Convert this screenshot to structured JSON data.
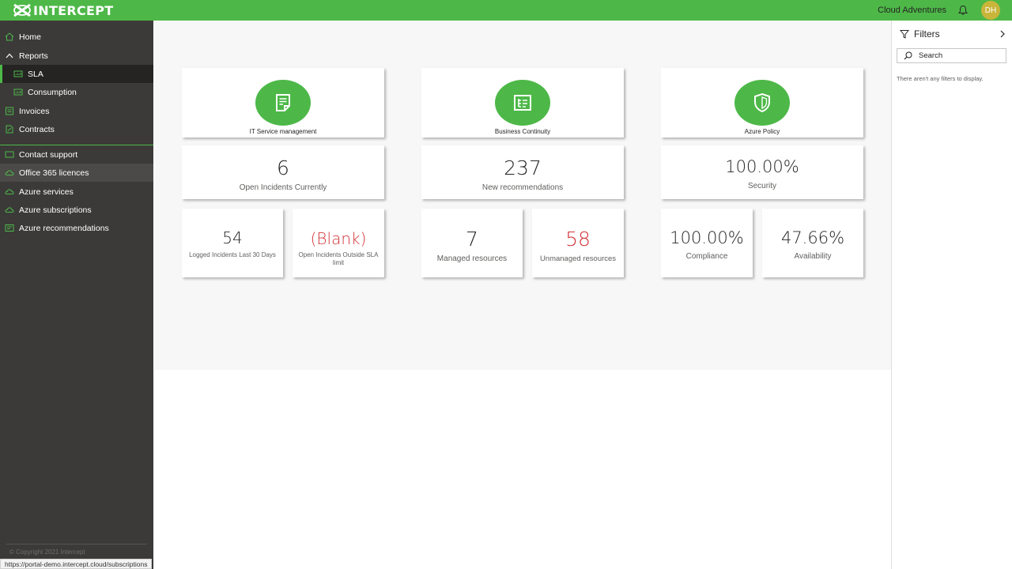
{
  "header": {
    "logo_text": "INTERCEPT",
    "tenant_name": "Cloud Adventures",
    "avatar_initials": "DH",
    "brand_color": "#4db848"
  },
  "sidebar": {
    "items": [
      {
        "label": "Home",
        "icon": "home-icon"
      },
      {
        "label": "Reports",
        "icon": "chevron-up-icon"
      },
      {
        "label": "SLA",
        "icon": "report-icon",
        "active": true
      },
      {
        "label": "Consumption",
        "icon": "report-icon"
      },
      {
        "label": "Invoices",
        "icon": "invoice-icon"
      },
      {
        "label": "Contracts",
        "icon": "contract-icon"
      },
      {
        "label": "Contact support",
        "icon": "support-icon"
      },
      {
        "label": "Office 365 licences",
        "icon": "cloud-icon"
      },
      {
        "label": "Azure services",
        "icon": "cloud-icon"
      },
      {
        "label": "Azure subscriptions",
        "icon": "cloud-icon"
      },
      {
        "label": "Azure recommendations",
        "icon": "recommendations-icon"
      }
    ],
    "copyright": "© Copyright 2021 Intercept"
  },
  "status_bar": {
    "url": "https://portal-demo.intercept.cloud/subscriptions"
  },
  "dashboard": {
    "itsm": {
      "title": "IT Service management",
      "open_incidents": {
        "value": "6",
        "label": "Open Incidents Currently"
      },
      "logged_incidents": {
        "value": "54",
        "label": "Logged Incidents Last 30 Days"
      },
      "outside_sla": {
        "value": "(Blank)",
        "label": "Open Incidents Outside SLA limit"
      }
    },
    "continuity": {
      "title": "Business Continuity",
      "recommendations": {
        "value": "237",
        "label": "New recommendations"
      },
      "managed": {
        "value": "7",
        "label": "Managed resources"
      },
      "unmanaged": {
        "value": "58",
        "label": "Unmanaged resources"
      }
    },
    "policy": {
      "title": "Azure Policy",
      "security": {
        "value": "100.00%",
        "label": "Security"
      },
      "compliance": {
        "value": "100.00%",
        "label": "Compliance"
      },
      "availability": {
        "value": "47.66%",
        "label": "Availability"
      }
    },
    "alert_color": "#d13438"
  },
  "filters": {
    "title": "Filters",
    "search_placeholder": "Search",
    "empty_message": "There aren't any filters to display."
  }
}
